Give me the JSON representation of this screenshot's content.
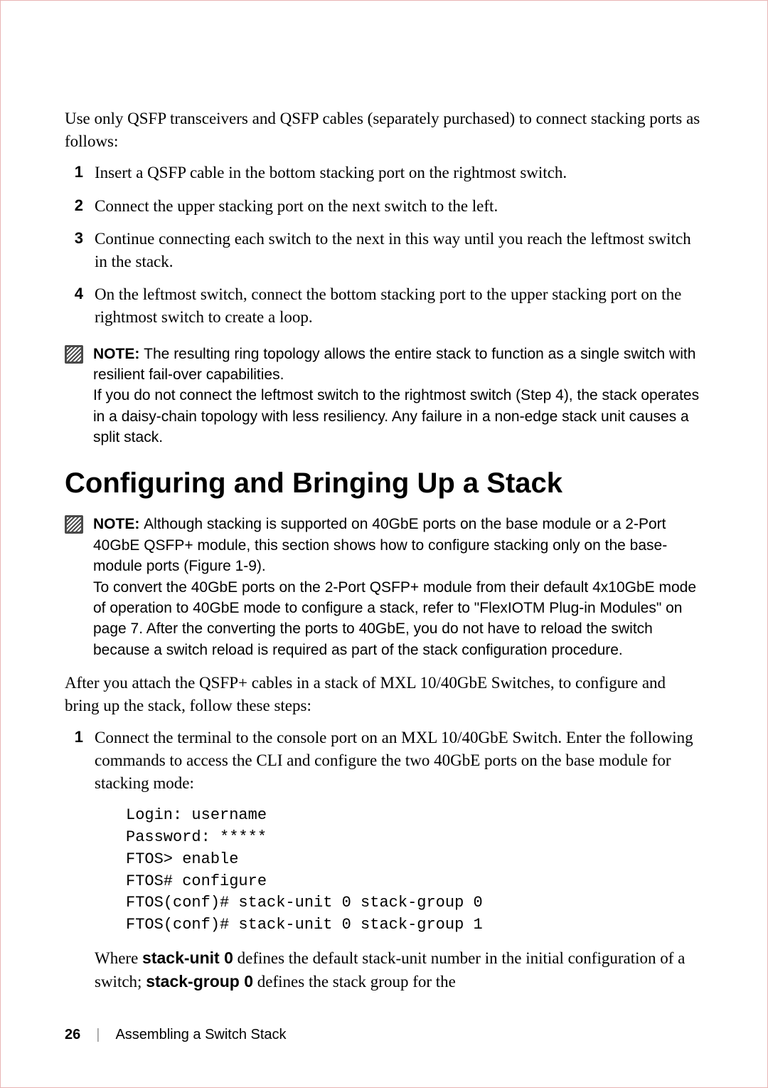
{
  "intro": "Use only QSFP transceivers and QSFP cables (separately purchased) to connect stacking ports as follows:",
  "steps1": [
    {
      "num": "1",
      "text": "Insert a QSFP cable in the bottom stacking port on the rightmost switch."
    },
    {
      "num": "2",
      "text": "Connect the upper stacking port on the next switch to the left."
    },
    {
      "num": "3",
      "text": "Continue connecting each switch to the next in this way until you reach the leftmost switch in the stack."
    },
    {
      "num": "4",
      "text": "On the leftmost switch, connect the bottom stacking port to the upper stacking port on the rightmost switch to create a loop."
    }
  ],
  "note1": {
    "label": "NOTE: ",
    "text": "The resulting ring topology allows the entire stack to function as a single switch with resilient fail-over capabilities.\nIf you do not connect the leftmost switch to the rightmost switch (Step 4), the stack operates in a daisy-chain topology with less resiliency. Any failure in a non-edge stack unit causes a split stack."
  },
  "heading": "Configuring and Bringing Up a Stack",
  "note2": {
    "label": "NOTE: ",
    "text": "Although stacking is supported on 40GbE ports on the base module or a 2-Port 40GbE QSFP+ module, this section shows how to configure stacking only on the base-module ports (Figure 1-9).\nTo convert the 40GbE ports on the 2-Port QSFP+ module from their default 4x10GbE mode of operation to 40GbE mode to configure a stack, refer to \"FlexIOTM Plug-in Modules\" on page 7. After the converting the ports to 40GbE, you do not have to reload the switch because a switch reload is required as part of the stack configuration procedure."
  },
  "after_note": "After you attach the QSFP+ cables in a stack of MXL 10/40GbE Switches, to configure and bring up the stack, follow these steps:",
  "step2_num": "1",
  "step2_text": "Connect the terminal to the console port on an MXL 10/40GbE Switch. Enter the following commands to access the CLI and configure the two 40GbE ports on the base module for stacking mode:",
  "code": "Login: username\nPassword: *****\nFTOS> enable\nFTOS# configure\nFTOS(conf)# stack-unit 0 stack-group 0\nFTOS(conf)# stack-unit 0 stack-group 1",
  "trailing_pre": "Where ",
  "trailing_bold1": "stack-unit 0",
  "trailing_mid": " defines the default stack-unit number in the initial configuration of a switch; ",
  "trailing_bold2": "stack-group 0",
  "trailing_post": " defines the stack group for the",
  "footer": {
    "page": "26",
    "divider": "|",
    "title": "Assembling a Switch Stack"
  }
}
